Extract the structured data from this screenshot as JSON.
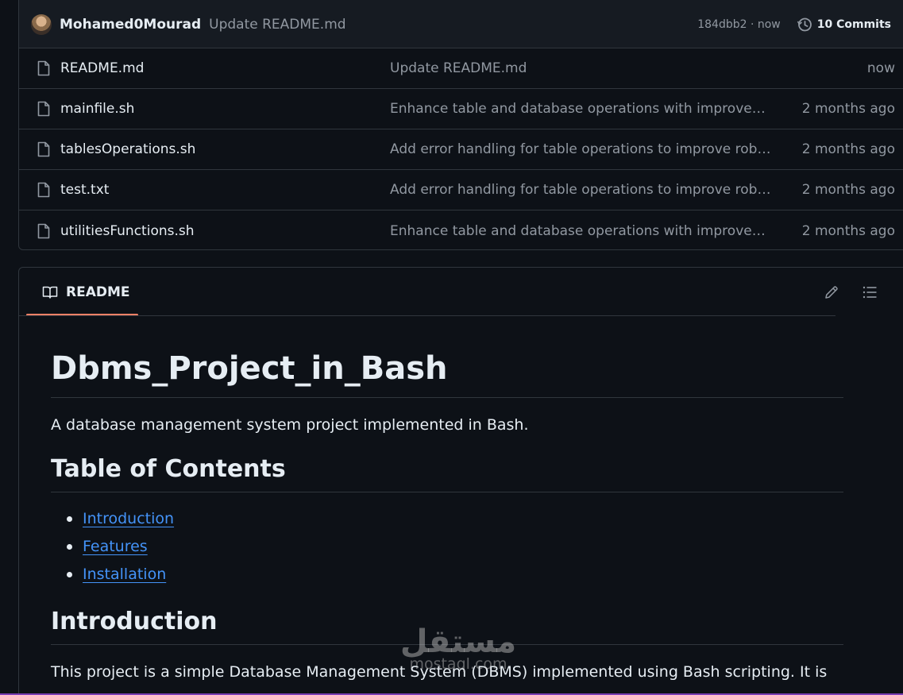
{
  "commit": {
    "author": "Mohamed0Mourad",
    "message": "Update README.md",
    "meta": "184dbb2 · now",
    "commits_label": "10 Commits"
  },
  "files": [
    {
      "name": "README.md",
      "commit": "Update README.md",
      "time": "now"
    },
    {
      "name": "mainfile.sh",
      "commit": "Enhance table and database operations with improved u...",
      "time": "2 months ago"
    },
    {
      "name": "tablesOperations.sh",
      "commit": "Add error handling for table operations to improve robu...",
      "time": "2 months ago"
    },
    {
      "name": "test.txt",
      "commit": "Add error handling for table operations to improve robu...",
      "time": "2 months ago"
    },
    {
      "name": "utilitiesFunctions.sh",
      "commit": "Enhance table and database operations with improved u...",
      "time": "2 months ago"
    }
  ],
  "readme": {
    "tab_label": "README",
    "title": "Dbms_Project_in_Bash",
    "intro": "A database management system project implemented in Bash.",
    "toc_heading": "Table of Contents",
    "toc": [
      "Introduction",
      "Features",
      "Installation"
    ],
    "introduction_heading": "Introduction",
    "introduction_text": "This project is a simple Database Management System (DBMS) implemented using Bash scripting. It is"
  },
  "watermark": {
    "arabic": "مستقل",
    "latin": "mostaql.com"
  },
  "colors": {
    "background": "#0d1117",
    "border": "#30363d",
    "link": "#4493f8",
    "tab_underline": "#f78166",
    "muted": "#9198a1"
  }
}
